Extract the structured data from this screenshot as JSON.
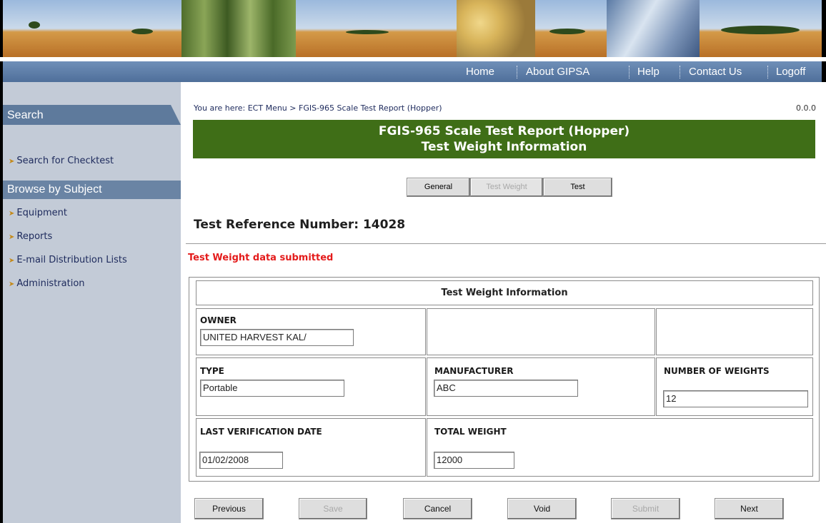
{
  "nav": {
    "home": "Home",
    "about": "About GIPSA",
    "help": "Help",
    "contact": "Contact Us",
    "logoff": "Logoff"
  },
  "sidebar": {
    "search_header": "Search",
    "search_link": "Search for Checktest",
    "browse_header": "Browse by Subject",
    "items": [
      {
        "label": "Equipment"
      },
      {
        "label": "Reports"
      },
      {
        "label": "E-mail Distribution Lists"
      },
      {
        "label": "Administration"
      }
    ]
  },
  "breadcrumb": "You are here:  ECT Menu > FGIS-965 Scale Test Report (Hopper)",
  "version": "0.0.0",
  "title": {
    "line1": "FGIS-965 Scale Test Report (Hopper)",
    "line2": "Test Weight Information"
  },
  "tabs": {
    "general": "General",
    "test_weight": "Test Weight",
    "test": "Test"
  },
  "reference": "Test Reference Number: 14028",
  "status_message": "Test Weight data submitted",
  "form": {
    "header": "Test Weight Information",
    "owner_label": "OWNER",
    "owner_value": "UNITED HARVEST KAL/",
    "type_label": "TYPE",
    "type_value": "Portable",
    "manufacturer_label": "MANUFACTURER",
    "manufacturer_value": "ABC",
    "num_weights_label": "NUMBER OF WEIGHTS",
    "num_weights_value": "12",
    "last_verification_label": "LAST VERIFICATION DATE",
    "last_verification_value": "01/02/2008",
    "total_weight_label": "TOTAL WEIGHT",
    "total_weight_value": "12000"
  },
  "actions": {
    "previous": "Previous",
    "save": "Save",
    "cancel": "Cancel",
    "void": "Void",
    "submit": "Submit",
    "next": "Next"
  },
  "colors": {
    "title_bar": "#3f6e17",
    "nav_bar": "#5f7fa9",
    "sidebar": "#c3cbd7",
    "status_message": "#e41b1b"
  }
}
